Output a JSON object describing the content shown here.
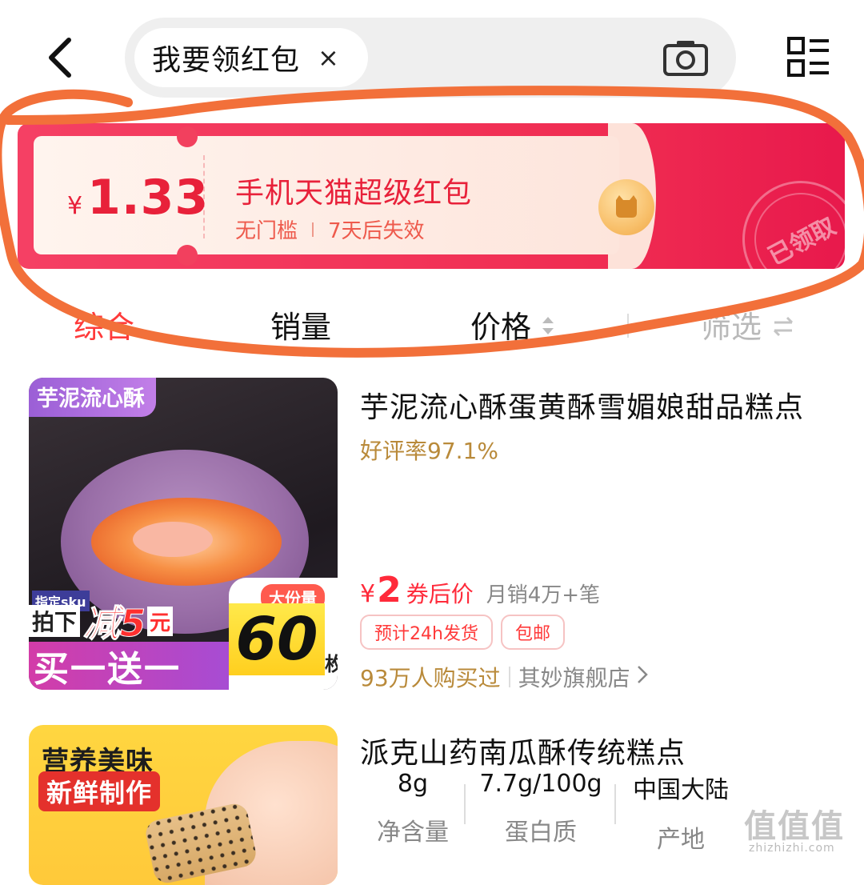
{
  "header": {
    "search_query": "我要领红包",
    "clear_symbol": "×",
    "icons": {
      "back": "chevron-left-icon",
      "camera": "camera-icon",
      "menu": "list-view-icon"
    }
  },
  "coupon": {
    "currency": "¥",
    "amount": "1.33",
    "title": "手机天猫超级红包",
    "threshold": "无门槛",
    "expiry": "7天后失效",
    "stamp_text": "已领取",
    "colors": {
      "accent": "#f02d52",
      "text": "#e8213a"
    }
  },
  "sort_bar": {
    "general": "综合",
    "sales": "销量",
    "price": "价格",
    "filter": "筛选"
  },
  "products": [
    {
      "image_badge": "芋泥流心酥",
      "image_promo_small": "指定sku",
      "image_promo_a": "拍下",
      "image_promo_b": "减5",
      "image_promo_c": "元",
      "image_strip": "买一送一",
      "image_qty_head": "大份量",
      "image_qty": "60",
      "image_qty_unit": "枚",
      "title": "芋泥流心酥蛋黄酥雪媚娘甜品糕点",
      "rating": "好评率97.1%",
      "price_currency": "¥",
      "price": "2",
      "price_label": "券后价",
      "monthly_sales": "月销4万+笔",
      "tags": [
        "预计24h发货",
        "包邮"
      ],
      "buyers": "93万人购买过",
      "store": "其妙旗舰店"
    },
    {
      "image_badge_1": "营养美味",
      "image_badge_2": "新鲜制作",
      "title": "派克山药南瓜酥传统糕点",
      "specs": [
        {
          "value": "8g",
          "key": "净含量"
        },
        {
          "value": "7.7g/100g",
          "key": "蛋白质"
        },
        {
          "value": "中国大陆",
          "key": "产地"
        }
      ]
    }
  ],
  "watermark": {
    "text": "值值值",
    "url": "zhizhizhi.com"
  },
  "annotation_color": "#f2703a"
}
